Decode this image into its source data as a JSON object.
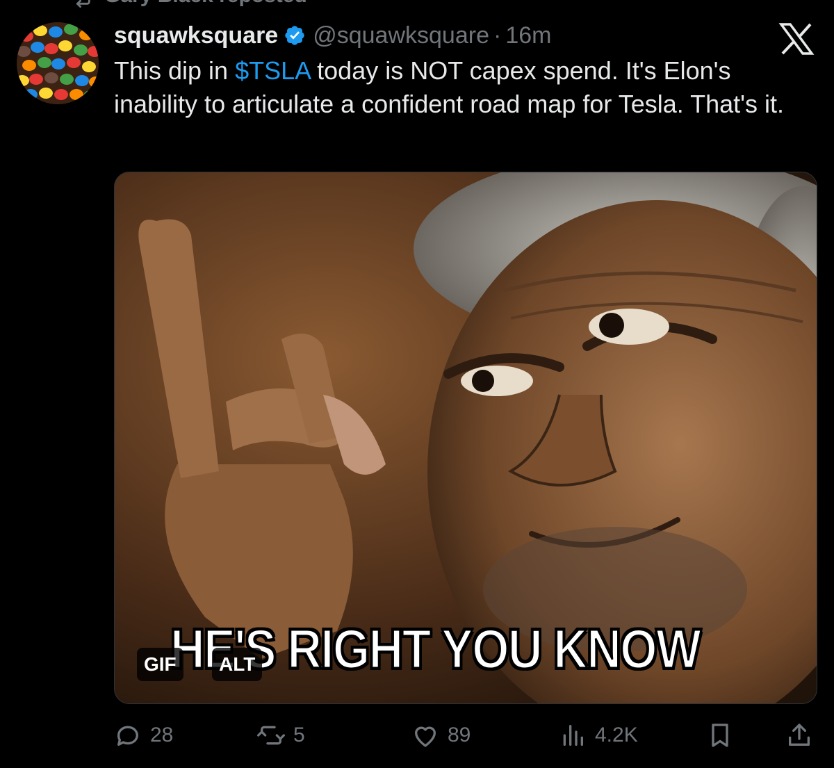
{
  "repost": {
    "label": "Gary Black reposted",
    "icon": "repost-icon"
  },
  "author": {
    "display_name": "squawksquare",
    "verified": true,
    "handle": "@squawksquare",
    "separator": "·",
    "time": "16m",
    "avatar_icon": "candy-avatar-icon"
  },
  "platform_logo": "x-logo-icon",
  "tweet": {
    "text_before": "This dip in ",
    "cashtag": "$TSLA",
    "text_after": " today is NOT capex spend. It's Elon's inability to articulate a confident road map for Tesla. That's it."
  },
  "media": {
    "type": "gif",
    "caption": "HE'S RIGHT YOU KNOW",
    "gif_badge": "GIF",
    "alt_badge": "ALT"
  },
  "actions": {
    "replies": "28",
    "reposts": "5",
    "likes": "89",
    "views": "4.2K"
  },
  "colors": {
    "background": "#000000",
    "text": "#e7e9ea",
    "secondary": "#71767b",
    "link": "#1d9bf0",
    "verified": "#1d9bf0"
  }
}
